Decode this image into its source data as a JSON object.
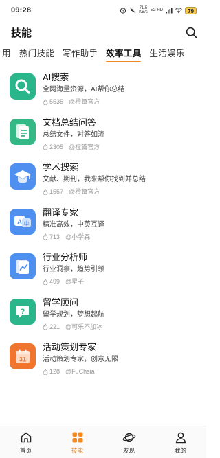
{
  "status": {
    "time": "09:28",
    "net_speed_value": "71.5",
    "net_speed_unit": "KB/s",
    "signal_label": "5G HD",
    "battery": "79"
  },
  "header": {
    "title": "技能"
  },
  "tabs": [
    {
      "label": "用"
    },
    {
      "label": "热门技能"
    },
    {
      "label": "写作助手"
    },
    {
      "label": "效率工具"
    },
    {
      "label": "生活娱乐"
    }
  ],
  "active_tab": "效率工具",
  "skills": [
    {
      "name": "AI搜索",
      "desc": "全网海量资源，AI帮你总结",
      "count": "5535",
      "author": "@橙篇官方",
      "icon": "magnifier-icon",
      "color": "#2bb58a"
    },
    {
      "name": "文档总结问答",
      "desc": "总结文件，对答如流",
      "count": "2305",
      "author": "@橙篇官方",
      "icon": "document-icon",
      "color": "#34b886"
    },
    {
      "name": "学术搜索",
      "desc": "文献、期刊，我来帮你找到并总结",
      "count": "1557",
      "author": "@橙篇官方",
      "icon": "graduation-cap-icon",
      "color": "#4e8ff0"
    },
    {
      "name": "翻译专家",
      "desc": "精准高效，中英互译",
      "count": "713",
      "author": "@小学森",
      "icon": "translate-icon",
      "color": "#4e8ff0"
    },
    {
      "name": "行业分析师",
      "desc": "行业洞察，趋势引领",
      "count": "499",
      "author": "@星子",
      "icon": "chart-report-icon",
      "color": "#4e8ff0"
    },
    {
      "name": "留学顾问",
      "desc": "留学规划，梦想起航",
      "count": "221",
      "author": "@可乐不加冰",
      "icon": "question-bubble-icon",
      "color": "#2bb58a"
    },
    {
      "name": "活动策划专家",
      "desc": "活动策划专家，创意无限",
      "count": "128",
      "author": "@FuChsia",
      "icon": "calendar-icon",
      "color": "#f0762f",
      "calendar_day": "31"
    }
  ],
  "bottom_nav": [
    {
      "label": "首页",
      "icon": "home-icon"
    },
    {
      "label": "技能",
      "icon": "skills-grid-icon"
    },
    {
      "label": "发现",
      "icon": "planet-icon"
    },
    {
      "label": "我的",
      "icon": "person-icon"
    }
  ],
  "accent_color": "#f08a24"
}
